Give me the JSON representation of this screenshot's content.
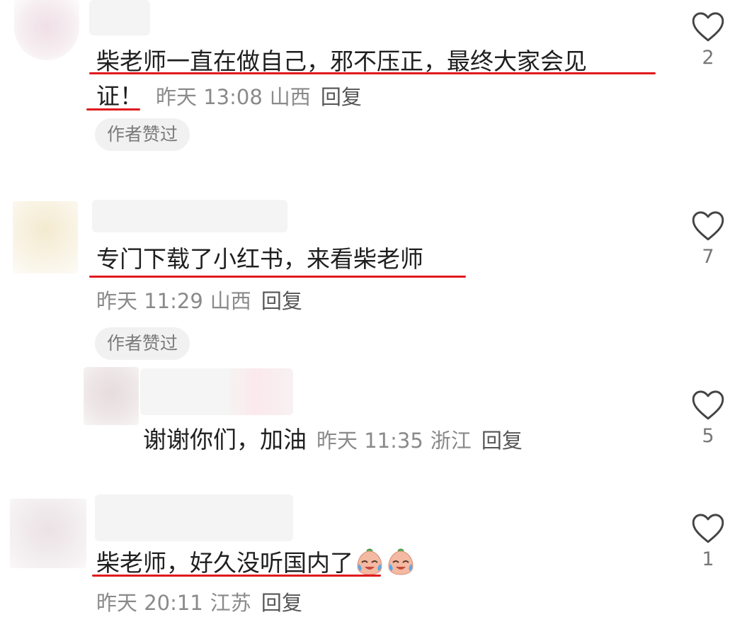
{
  "comments": [
    {
      "text_line1": "柴老师一直在做自己，邪不压正，最终大家会见",
      "text_line2": "证！",
      "time": "昨天 13:08",
      "location": "山西",
      "reply_label": "回复",
      "badge": "作者赞过",
      "likes": "2"
    },
    {
      "text": "专门下载了小红书，来看柴老师",
      "time": "昨天 11:29",
      "location": "山西",
      "reply_label": "回复",
      "badge": "作者赞过",
      "likes": "7"
    },
    {
      "text": "谢谢你们，加油",
      "time": "昨天 11:35",
      "location": "浙江",
      "reply_label": "回复",
      "likes": "5"
    },
    {
      "text": "柴老师，好久没听国内了",
      "emojis": [
        "crying-laughing-emoji",
        "crying-laughing-emoji"
      ],
      "time": "昨天 20:11",
      "location": "江苏",
      "reply_label": "回复",
      "likes": "1"
    }
  ],
  "icons": {
    "like": "heart-outline-icon"
  },
  "colors": {
    "underline": "#e0191d",
    "meta_text": "#8a8a8a",
    "badge_bg": "#f1f1f1"
  }
}
